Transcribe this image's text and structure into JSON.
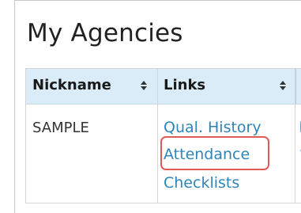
{
  "page": {
    "title": "My Agencies"
  },
  "table": {
    "columns": [
      {
        "label": "Nickname",
        "sortable": true
      },
      {
        "label": "Links",
        "sortable": true
      }
    ],
    "rows": [
      {
        "nickname": "SAMPLE",
        "links": [
          "Qual. History",
          "Attendance",
          "Checklists"
        ]
      }
    ]
  },
  "colors": {
    "header_bg": "#d9ecf7",
    "link": "#2e86b8",
    "highlight": "#e05a5a"
  },
  "icons": {
    "sort": "sort-arrows-icon"
  }
}
